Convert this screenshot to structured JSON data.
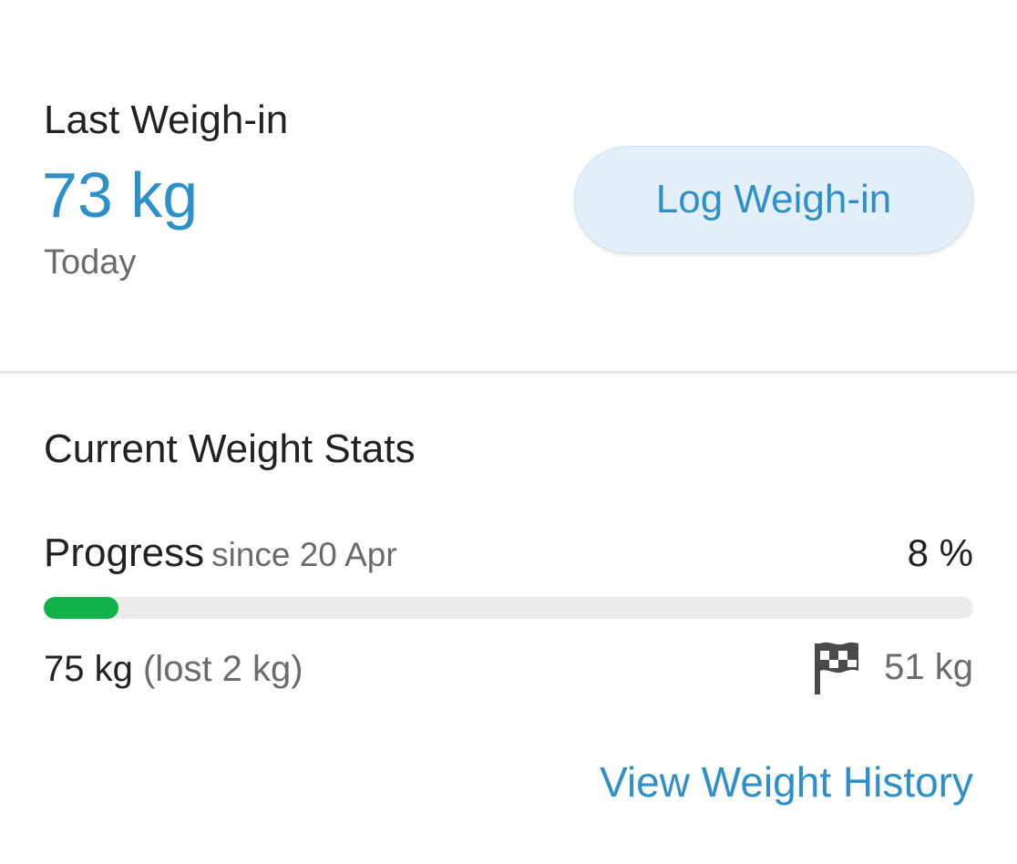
{
  "last_weigh_in": {
    "label": "Last Weigh-in",
    "value": "73 kg",
    "when": "Today",
    "log_button_label": "Log Weigh-in"
  },
  "stats": {
    "title": "Current Weight Stats",
    "progress_label": "Progress",
    "progress_since": "since 20 Apr",
    "progress_percent_text": "8 %",
    "progress_fraction": 0.08,
    "start_weight": "75 kg",
    "lost_text": "(lost 2 kg)",
    "goal_weight": "51 kg",
    "goal_icon": "flag-icon",
    "history_link": "View Weight History"
  },
  "colors": {
    "accent": "#2e90c8",
    "progress_fill": "#12b24a",
    "progress_track": "#ececec",
    "button_bg": "#e3f0f9"
  }
}
